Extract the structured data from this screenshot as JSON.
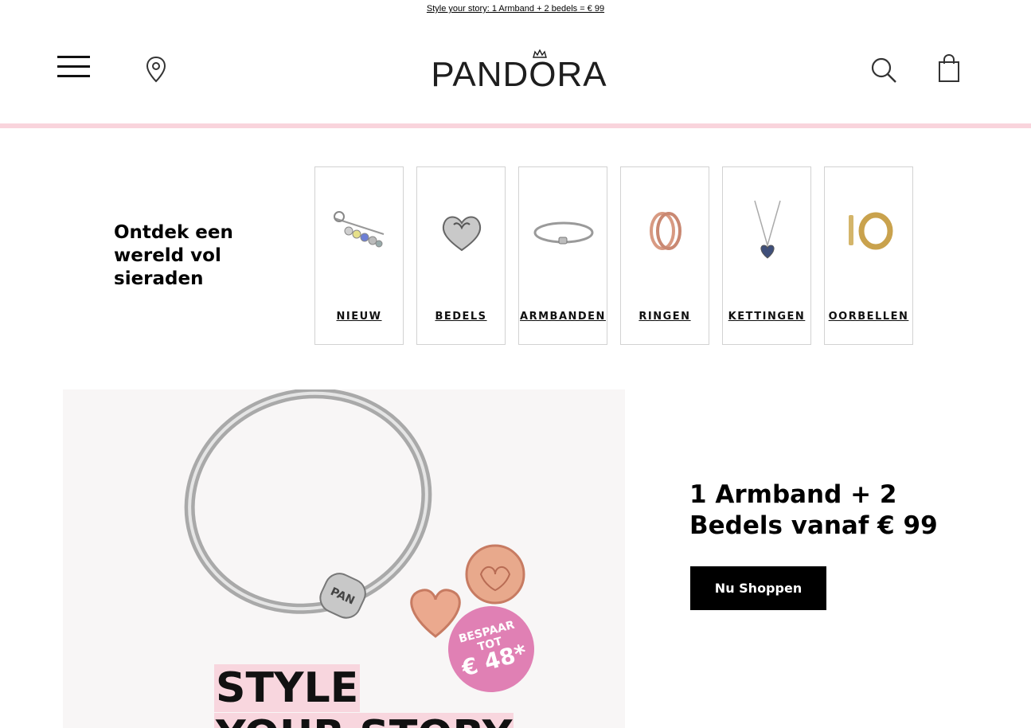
{
  "promo": {
    "text": "Style your story: 1 Armband + 2 bedels = € 99"
  },
  "header": {
    "logo_text": "PANDORA",
    "icons": [
      "menu-icon",
      "location-pin-icon",
      "search-icon",
      "shopping-bag-icon"
    ]
  },
  "colors": {
    "accent_pink": "#f9d4dc",
    "badge_pink": "#e080b4",
    "cta_black": "#000000"
  },
  "intro": {
    "heading": "Ontdek een wereld vol sieraden"
  },
  "categories": [
    {
      "label": "NIEUW"
    },
    {
      "label": "BEDELS"
    },
    {
      "label": "ARMBANDEN"
    },
    {
      "label": "RINGEN"
    },
    {
      "label": "KETTINGEN"
    },
    {
      "label": "OORBELLEN"
    }
  ],
  "hero": {
    "title_line1": "STYLE",
    "title_line2": "YOUR STORY",
    "clasp_text": "PAN",
    "badge_line1": "BESPAAR",
    "badge_line2": "TOT",
    "badge_value": "€ 48*"
  },
  "offer": {
    "heading": "1 Armband + 2 Bedels vanaf € 99",
    "button_label": "Nu Shoppen"
  }
}
